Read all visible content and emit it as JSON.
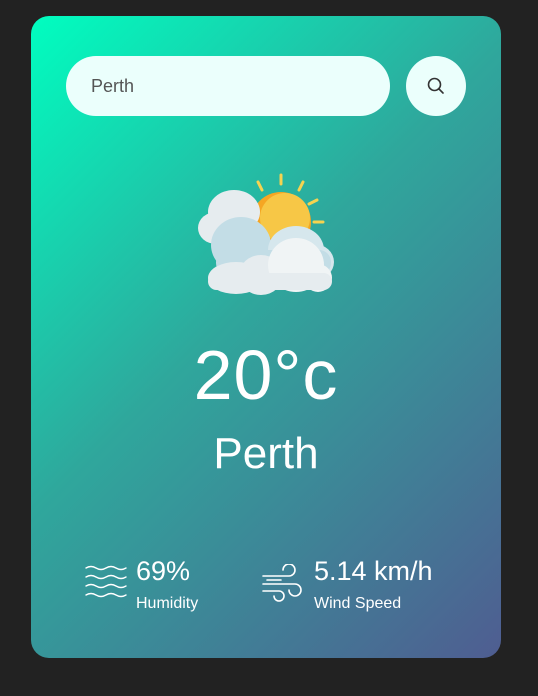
{
  "search": {
    "value": "Perth",
    "placeholder": "",
    "button_icon": "search-icon"
  },
  "weather": {
    "icon": "partly-cloudy-sun-icon",
    "temperature": "20°c",
    "city": "Perth"
  },
  "details": {
    "humidity": {
      "value": "69%",
      "label": "Humidity",
      "icon": "waves-icon"
    },
    "wind": {
      "value": "5.14 km/h",
      "label": "Wind Speed",
      "icon": "wind-icon"
    }
  },
  "colors": {
    "page_background": "#222222",
    "gradient_start": "#00fec0",
    "gradient_end": "#4f5d91",
    "input_background": "#ebfffc",
    "text": "#ffffff"
  }
}
